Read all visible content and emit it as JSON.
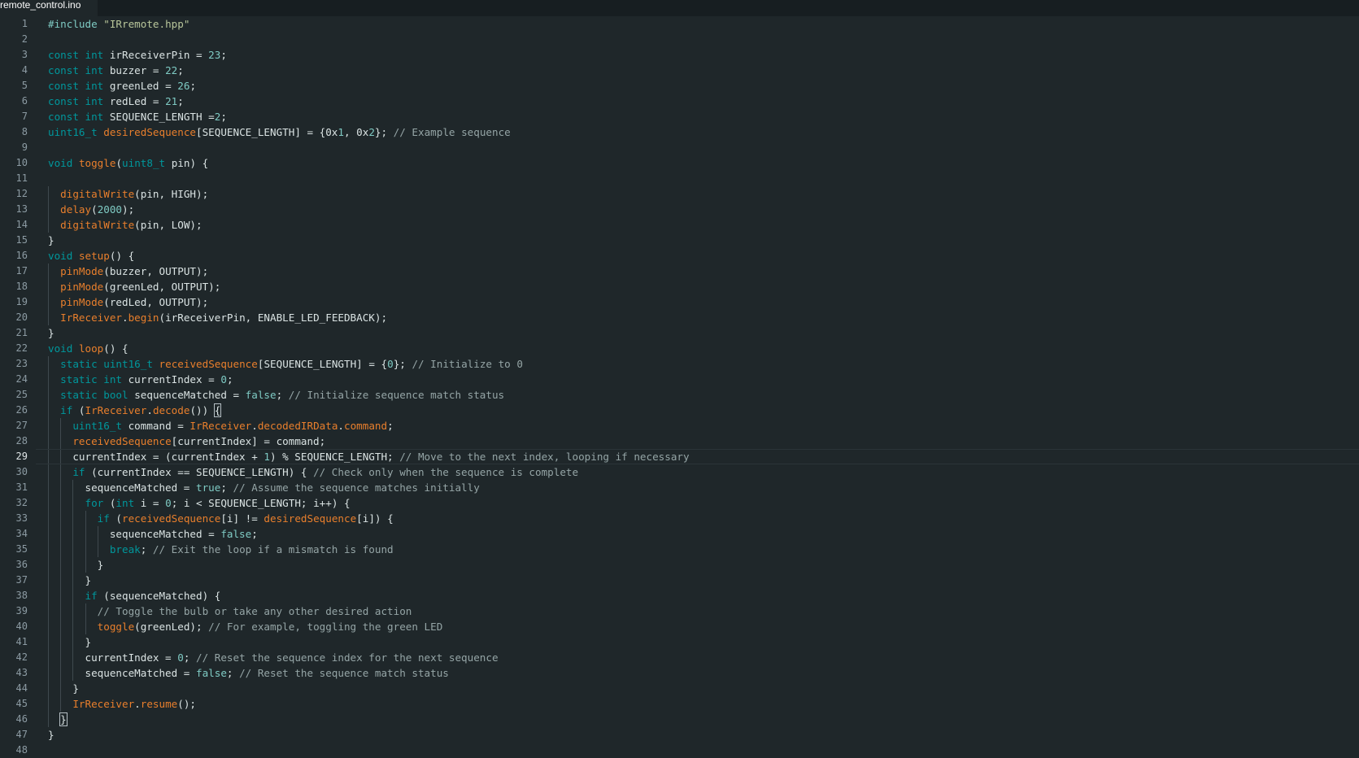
{
  "tab": {
    "filename": "remote_control.ino"
  },
  "editor": {
    "active_line": 29,
    "lines": [
      [
        [
          "d",
          "#include "
        ],
        [
          "s",
          "\"IRremote.hpp\""
        ]
      ],
      [],
      [
        [
          "k",
          "const"
        ],
        [
          "x",
          " "
        ],
        [
          "k",
          "int"
        ],
        [
          "x",
          " irReceiverPin = "
        ],
        [
          "n",
          "23"
        ],
        [
          "x",
          ";"
        ]
      ],
      [
        [
          "k",
          "const"
        ],
        [
          "x",
          " "
        ],
        [
          "k",
          "int"
        ],
        [
          "x",
          " buzzer = "
        ],
        [
          "n",
          "22"
        ],
        [
          "x",
          ";"
        ]
      ],
      [
        [
          "k",
          "const"
        ],
        [
          "x",
          " "
        ],
        [
          "k",
          "int"
        ],
        [
          "x",
          " greenLed = "
        ],
        [
          "n",
          "26"
        ],
        [
          "x",
          ";"
        ]
      ],
      [
        [
          "k",
          "const"
        ],
        [
          "x",
          " "
        ],
        [
          "k",
          "int"
        ],
        [
          "x",
          " redLed = "
        ],
        [
          "n",
          "21"
        ],
        [
          "x",
          ";"
        ]
      ],
      [
        [
          "k",
          "const"
        ],
        [
          "x",
          " "
        ],
        [
          "k",
          "int"
        ],
        [
          "x",
          " SEQUENCE_LENGTH ="
        ],
        [
          "n",
          "2"
        ],
        [
          "x",
          ";"
        ]
      ],
      [
        [
          "k",
          "uint16_t"
        ],
        [
          "x",
          " "
        ],
        [
          "f",
          "desiredSequence"
        ],
        [
          "x",
          "[SEQUENCE_LENGTH] = {0x"
        ],
        [
          "n",
          "1"
        ],
        [
          "x",
          ", 0x"
        ],
        [
          "n",
          "2"
        ],
        [
          "x",
          "}; "
        ],
        [
          "c",
          "// Example sequence"
        ]
      ],
      [],
      [
        [
          "k",
          "void"
        ],
        [
          "x",
          " "
        ],
        [
          "f",
          "toggle"
        ],
        [
          "x",
          "("
        ],
        [
          "k",
          "uint8_t"
        ],
        [
          "x",
          " pin) {"
        ]
      ],
      [],
      [
        [
          "x",
          "  "
        ],
        [
          "f",
          "digitalWrite"
        ],
        [
          "x",
          "(pin, HIGH);"
        ]
      ],
      [
        [
          "x",
          "  "
        ],
        [
          "f",
          "delay"
        ],
        [
          "x",
          "("
        ],
        [
          "n",
          "2000"
        ],
        [
          "x",
          ");"
        ]
      ],
      [
        [
          "x",
          "  "
        ],
        [
          "f",
          "digitalWrite"
        ],
        [
          "x",
          "(pin, LOW);"
        ]
      ],
      [
        [
          "x",
          "}"
        ]
      ],
      [
        [
          "k",
          "void"
        ],
        [
          "x",
          " "
        ],
        [
          "f",
          "setup"
        ],
        [
          "x",
          "() {"
        ]
      ],
      [
        [
          "x",
          "  "
        ],
        [
          "f",
          "pinMode"
        ],
        [
          "x",
          "(buzzer, OUTPUT);"
        ]
      ],
      [
        [
          "x",
          "  "
        ],
        [
          "f",
          "pinMode"
        ],
        [
          "x",
          "(greenLed, OUTPUT);"
        ]
      ],
      [
        [
          "x",
          "  "
        ],
        [
          "f",
          "pinMode"
        ],
        [
          "x",
          "(redLed, OUTPUT);"
        ]
      ],
      [
        [
          "x",
          "  "
        ],
        [
          "f",
          "IrReceiver"
        ],
        [
          "x",
          "."
        ],
        [
          "f",
          "begin"
        ],
        [
          "x",
          "(irReceiverPin, ENABLE_LED_FEEDBACK);"
        ]
      ],
      [
        [
          "x",
          "}"
        ]
      ],
      [
        [
          "k",
          "void"
        ],
        [
          "x",
          " "
        ],
        [
          "f",
          "loop"
        ],
        [
          "x",
          "() {"
        ]
      ],
      [
        [
          "x",
          "  "
        ],
        [
          "k",
          "static"
        ],
        [
          "x",
          " "
        ],
        [
          "k",
          "uint16_t"
        ],
        [
          "x",
          " "
        ],
        [
          "f",
          "receivedSequence"
        ],
        [
          "x",
          "[SEQUENCE_LENGTH] = {"
        ],
        [
          "n",
          "0"
        ],
        [
          "x",
          "}; "
        ],
        [
          "c",
          "// Initialize to 0"
        ]
      ],
      [
        [
          "x",
          "  "
        ],
        [
          "k",
          "static"
        ],
        [
          "x",
          " "
        ],
        [
          "k",
          "int"
        ],
        [
          "x",
          " currentIndex = "
        ],
        [
          "n",
          "0"
        ],
        [
          "x",
          ";"
        ]
      ],
      [
        [
          "x",
          "  "
        ],
        [
          "k",
          "static"
        ],
        [
          "x",
          " "
        ],
        [
          "k",
          "bool"
        ],
        [
          "x",
          " sequenceMatched = "
        ],
        [
          "n",
          "false"
        ],
        [
          "x",
          "; "
        ],
        [
          "c",
          "// Initialize sequence match status"
        ]
      ],
      [
        [
          "x",
          "  "
        ],
        [
          "k",
          "if"
        ],
        [
          "x",
          " ("
        ],
        [
          "f",
          "IrReceiver"
        ],
        [
          "x",
          "."
        ],
        [
          "f",
          "decode"
        ],
        [
          "x",
          "()) "
        ],
        [
          "b",
          "{"
        ]
      ],
      [
        [
          "x",
          "    "
        ],
        [
          "k",
          "uint16_t"
        ],
        [
          "x",
          " command = "
        ],
        [
          "f",
          "IrReceiver"
        ],
        [
          "x",
          "."
        ],
        [
          "f",
          "decodedIRData"
        ],
        [
          "x",
          "."
        ],
        [
          "f",
          "command"
        ],
        [
          "x",
          ";"
        ]
      ],
      [
        [
          "x",
          "    "
        ],
        [
          "f",
          "receivedSequence"
        ],
        [
          "x",
          "[currentIndex] = command;"
        ]
      ],
      [
        [
          "x",
          "    currentIndex = (currentIndex + "
        ],
        [
          "n",
          "1"
        ],
        [
          "x",
          ") % SEQUENCE_LENGTH; "
        ],
        [
          "c",
          "// Move to the next index, looping if necessary"
        ]
      ],
      [
        [
          "x",
          "    "
        ],
        [
          "k",
          "if"
        ],
        [
          "x",
          " (currentIndex == SEQUENCE_LENGTH) { "
        ],
        [
          "c",
          "// Check only when the sequence is complete"
        ]
      ],
      [
        [
          "x",
          "      sequenceMatched = "
        ],
        [
          "n",
          "true"
        ],
        [
          "x",
          "; "
        ],
        [
          "c",
          "// Assume the sequence matches initially"
        ]
      ],
      [
        [
          "x",
          "      "
        ],
        [
          "k",
          "for"
        ],
        [
          "x",
          " ("
        ],
        [
          "k",
          "int"
        ],
        [
          "x",
          " i = "
        ],
        [
          "n",
          "0"
        ],
        [
          "x",
          "; i < SEQUENCE_LENGTH; i++) {"
        ]
      ],
      [
        [
          "x",
          "        "
        ],
        [
          "k",
          "if"
        ],
        [
          "x",
          " ("
        ],
        [
          "f",
          "receivedSequence"
        ],
        [
          "x",
          "[i] != "
        ],
        [
          "f",
          "desiredSequence"
        ],
        [
          "x",
          "[i]) {"
        ]
      ],
      [
        [
          "x",
          "          sequenceMatched = "
        ],
        [
          "n",
          "false"
        ],
        [
          "x",
          ";"
        ]
      ],
      [
        [
          "x",
          "          "
        ],
        [
          "k",
          "break"
        ],
        [
          "x",
          "; "
        ],
        [
          "c",
          "// Exit the loop if a mismatch is found"
        ]
      ],
      [
        [
          "x",
          "        }"
        ]
      ],
      [
        [
          "x",
          "      }"
        ]
      ],
      [
        [
          "x",
          "      "
        ],
        [
          "k",
          "if"
        ],
        [
          "x",
          " (sequenceMatched) {"
        ]
      ],
      [
        [
          "x",
          "        "
        ],
        [
          "c",
          "// Toggle the bulb or take any other desired action"
        ]
      ],
      [
        [
          "x",
          "        "
        ],
        [
          "f",
          "toggle"
        ],
        [
          "x",
          "(greenLed); "
        ],
        [
          "c",
          "// For example, toggling the green LED"
        ]
      ],
      [
        [
          "x",
          "      }"
        ]
      ],
      [
        [
          "x",
          "      currentIndex = "
        ],
        [
          "n",
          "0"
        ],
        [
          "x",
          "; "
        ],
        [
          "c",
          "// Reset the sequence index for the next sequence"
        ]
      ],
      [
        [
          "x",
          "      sequenceMatched = "
        ],
        [
          "n",
          "false"
        ],
        [
          "x",
          "; "
        ],
        [
          "c",
          "// Reset the sequence match status"
        ]
      ],
      [
        [
          "x",
          "    }"
        ]
      ],
      [
        [
          "x",
          "    "
        ],
        [
          "f",
          "IrReceiver"
        ],
        [
          "x",
          "."
        ],
        [
          "f",
          "resume"
        ],
        [
          "x",
          "();"
        ]
      ],
      [
        [
          "x",
          "  "
        ],
        [
          "b",
          "}"
        ]
      ],
      [
        [
          "x",
          "}"
        ]
      ],
      []
    ]
  }
}
